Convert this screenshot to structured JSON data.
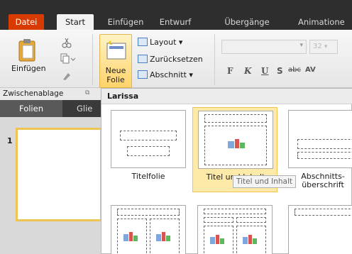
{
  "tabs": {
    "datei": "Datei",
    "start": "Start",
    "einfuegen": "Einfügen",
    "entwurf": "Entwurf",
    "uebergaenge": "Übergänge",
    "animationen": "Animatione"
  },
  "ribbon": {
    "paste_label": "Einfügen",
    "new_slide_line1": "Neue",
    "new_slide_line2": "Folie",
    "layout_label": "Layout",
    "reset_label": "Zurücksetzen",
    "section_label": "Abschnitt",
    "font_size": "32",
    "clipboard_group": "Zwischenablage",
    "format_buttons": [
      "F",
      "K",
      "U",
      "S",
      "abc",
      "AV"
    ]
  },
  "left_panel": {
    "tab_slides": "Folien",
    "tab_outline": "Glie",
    "slide_number": "1"
  },
  "gallery": {
    "title": "Larissa",
    "items": [
      {
        "label": "Titelfolie"
      },
      {
        "label": "Titel und Inhalt"
      },
      {
        "label": "Abschnitts-überschrift"
      }
    ],
    "tooltip": "Titel und Inhalt"
  }
}
